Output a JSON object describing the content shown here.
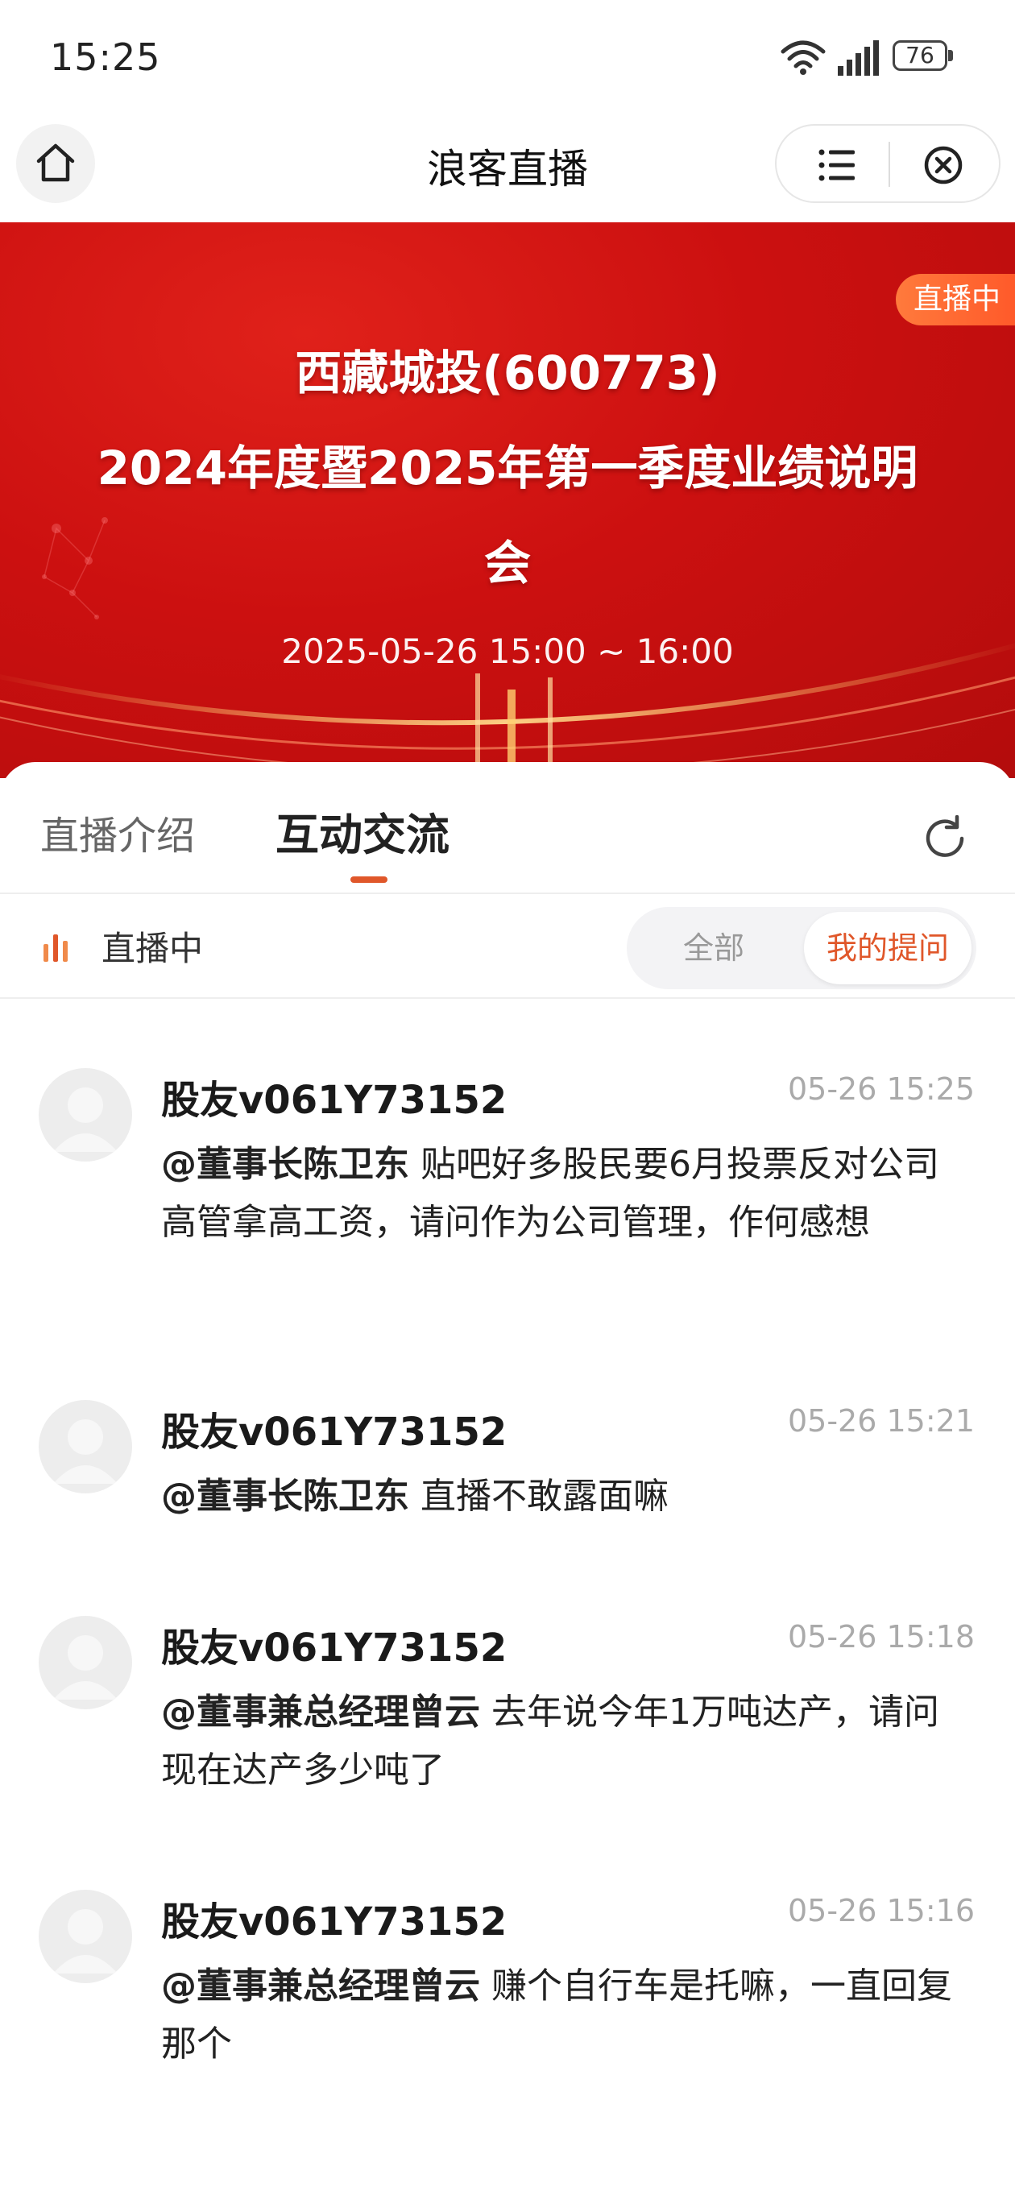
{
  "status": {
    "time": "15:25",
    "battery": "76"
  },
  "nav": {
    "title": "浪客直播"
  },
  "banner": {
    "live_tag": "直播中",
    "line1": "西藏城投(600773)",
    "line2": "2024年度暨2025年第一季度业绩说明",
    "line3": "会",
    "time_range": "2025-05-26 15:00 ~ 16:00"
  },
  "tabs": {
    "intro": "直播介绍",
    "interact": "互动交流"
  },
  "filter": {
    "live_label": "直播中",
    "all": "全部",
    "mine": "我的提问"
  },
  "messages": [
    {
      "user": "股友v061Y73152",
      "time": "05-26 15:25",
      "mention": "@董事长陈卫东",
      "text": " 贴吧好多股民要6月投票反对公司高管拿高工资，请问作为公司管理，作何感想"
    },
    {
      "user": "股友v061Y73152",
      "time": "05-26 15:21",
      "mention": "@董事长陈卫东",
      "text": " 直播不敢露面嘛"
    },
    {
      "user": "股友v061Y73152",
      "time": "05-26 15:18",
      "mention": "@董事兼总经理曾云",
      "text": " 去年说今年1万吨达产，请问现在达产多少吨了"
    },
    {
      "user": "股友v061Y73152",
      "time": "05-26 15:16",
      "mention": "@董事兼总经理曾云",
      "text": " 赚个自行车是托嘛，一直回复那个"
    }
  ],
  "colors": {
    "accent": "#e0572a",
    "banner_red": "#cc1010"
  }
}
